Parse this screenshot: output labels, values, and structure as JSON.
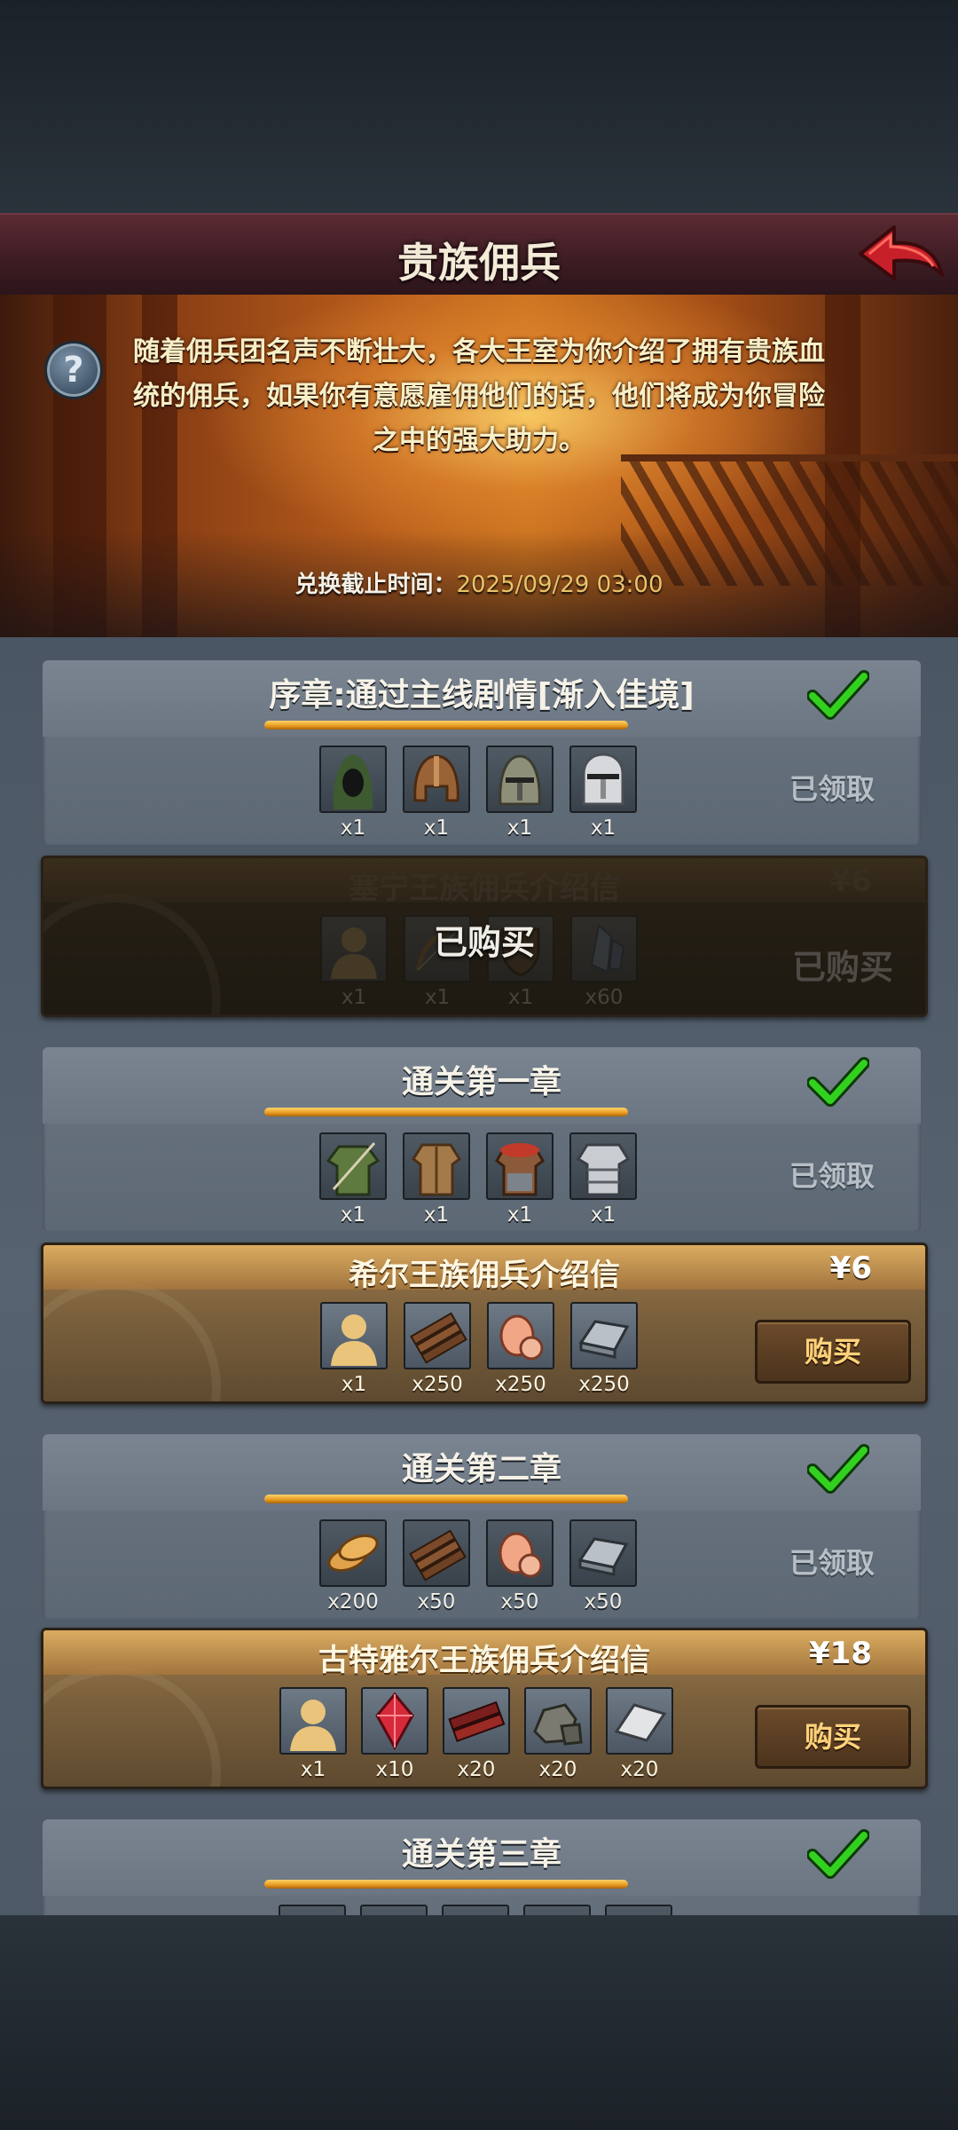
{
  "header": {
    "title": "贵族佣兵"
  },
  "banner": {
    "intro": "随着佣兵团名声不断壮大，各大王室为你介绍了拥有贵族血统的佣兵，如果你有意愿雇佣他们的话，他们将成为你冒险之中的强大助力。",
    "deadline_label": "兑换截止时间：",
    "deadline_value": "2025/09/29 03:00"
  },
  "chapters": [
    {
      "title": "序章:通过主线剧情[渐入佳境]",
      "status": "已领取",
      "rewards": [
        {
          "icon": "hood-icon",
          "qty": "x1"
        },
        {
          "icon": "leather-helmet-icon",
          "qty": "x1"
        },
        {
          "icon": "iron-helm-icon",
          "qty": "x1"
        },
        {
          "icon": "silver-helm-icon",
          "qty": "x1"
        }
      ],
      "offer": {
        "title": "塞宁王族佣兵介绍信",
        "price": "¥6",
        "purchased": true,
        "purchased_label": "已购买",
        "rewards": [
          {
            "icon": "mercenary-silhouette-icon",
            "qty": "x1"
          },
          {
            "icon": "bow-icon",
            "qty": "x1"
          },
          {
            "icon": "shield-icon",
            "qty": "x1"
          },
          {
            "icon": "crystal-icon",
            "qty": "x60"
          }
        ]
      }
    },
    {
      "title": "通关第一章",
      "status": "已领取",
      "rewards": [
        {
          "icon": "green-tunic-icon",
          "qty": "x1"
        },
        {
          "icon": "leather-armor-icon",
          "qty": "x1"
        },
        {
          "icon": "fur-armor-icon",
          "qty": "x1"
        },
        {
          "icon": "plate-armor-icon",
          "qty": "x1"
        }
      ],
      "offer": {
        "title": "希尔王族佣兵介绍信",
        "price": "¥6",
        "purchased": false,
        "buy_label": "购买",
        "rewards": [
          {
            "icon": "mercenary-silhouette-icon",
            "qty": "x1"
          },
          {
            "icon": "wood-planks-icon",
            "qty": "x250"
          },
          {
            "icon": "meat-icon",
            "qty": "x250"
          },
          {
            "icon": "iron-ingot-icon",
            "qty": "x250"
          }
        ]
      }
    },
    {
      "title": "通关第二章",
      "status": "已领取",
      "rewards": [
        {
          "icon": "bread-icon",
          "qty": "x200"
        },
        {
          "icon": "wood-planks-icon",
          "qty": "x50"
        },
        {
          "icon": "meat-icon",
          "qty": "x50"
        },
        {
          "icon": "iron-ingot-icon",
          "qty": "x50"
        }
      ],
      "offer": {
        "title": "古特雅尔王族佣兵介绍信",
        "price": "¥18",
        "purchased": false,
        "buy_label": "购买",
        "rewards": [
          {
            "icon": "mercenary-silhouette-icon",
            "qty": "x1"
          },
          {
            "icon": "red-gem-icon",
            "qty": "x10"
          },
          {
            "icon": "hardwood-icon",
            "qty": "x20"
          },
          {
            "icon": "stone-icon",
            "qty": "x20"
          },
          {
            "icon": "silver-ingot-icon",
            "qty": "x20"
          }
        ]
      }
    },
    {
      "title": "通关第三章",
      "status": ""
    }
  ],
  "colors": {
    "header_bg": "#4a2129",
    "gold_accent": "#e69a1f",
    "deadline": "#e8c46a",
    "check_green": "#33d11f"
  }
}
